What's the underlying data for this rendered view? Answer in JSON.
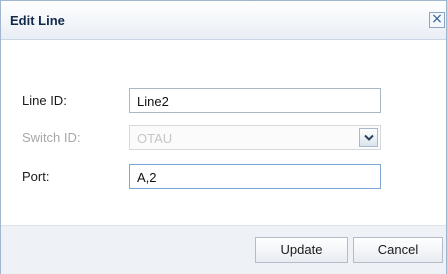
{
  "dialog": {
    "title": "Edit Line",
    "close_symbol": "×"
  },
  "form": {
    "line_id": {
      "label": "Line ID:",
      "value": "Line2"
    },
    "switch_id": {
      "label": "Switch ID:",
      "value": "OTAU",
      "disabled": true
    },
    "port": {
      "label": "Port:",
      "value": "A,2"
    }
  },
  "buttons": {
    "update": "Update",
    "cancel": "Cancel"
  },
  "icons": {
    "close": "close-icon",
    "dropdown": "chevron-down-icon"
  },
  "colors": {
    "title_text": "#12294a",
    "accent_border": "#7ea6d6",
    "footer_bg": "#eef1f5"
  }
}
